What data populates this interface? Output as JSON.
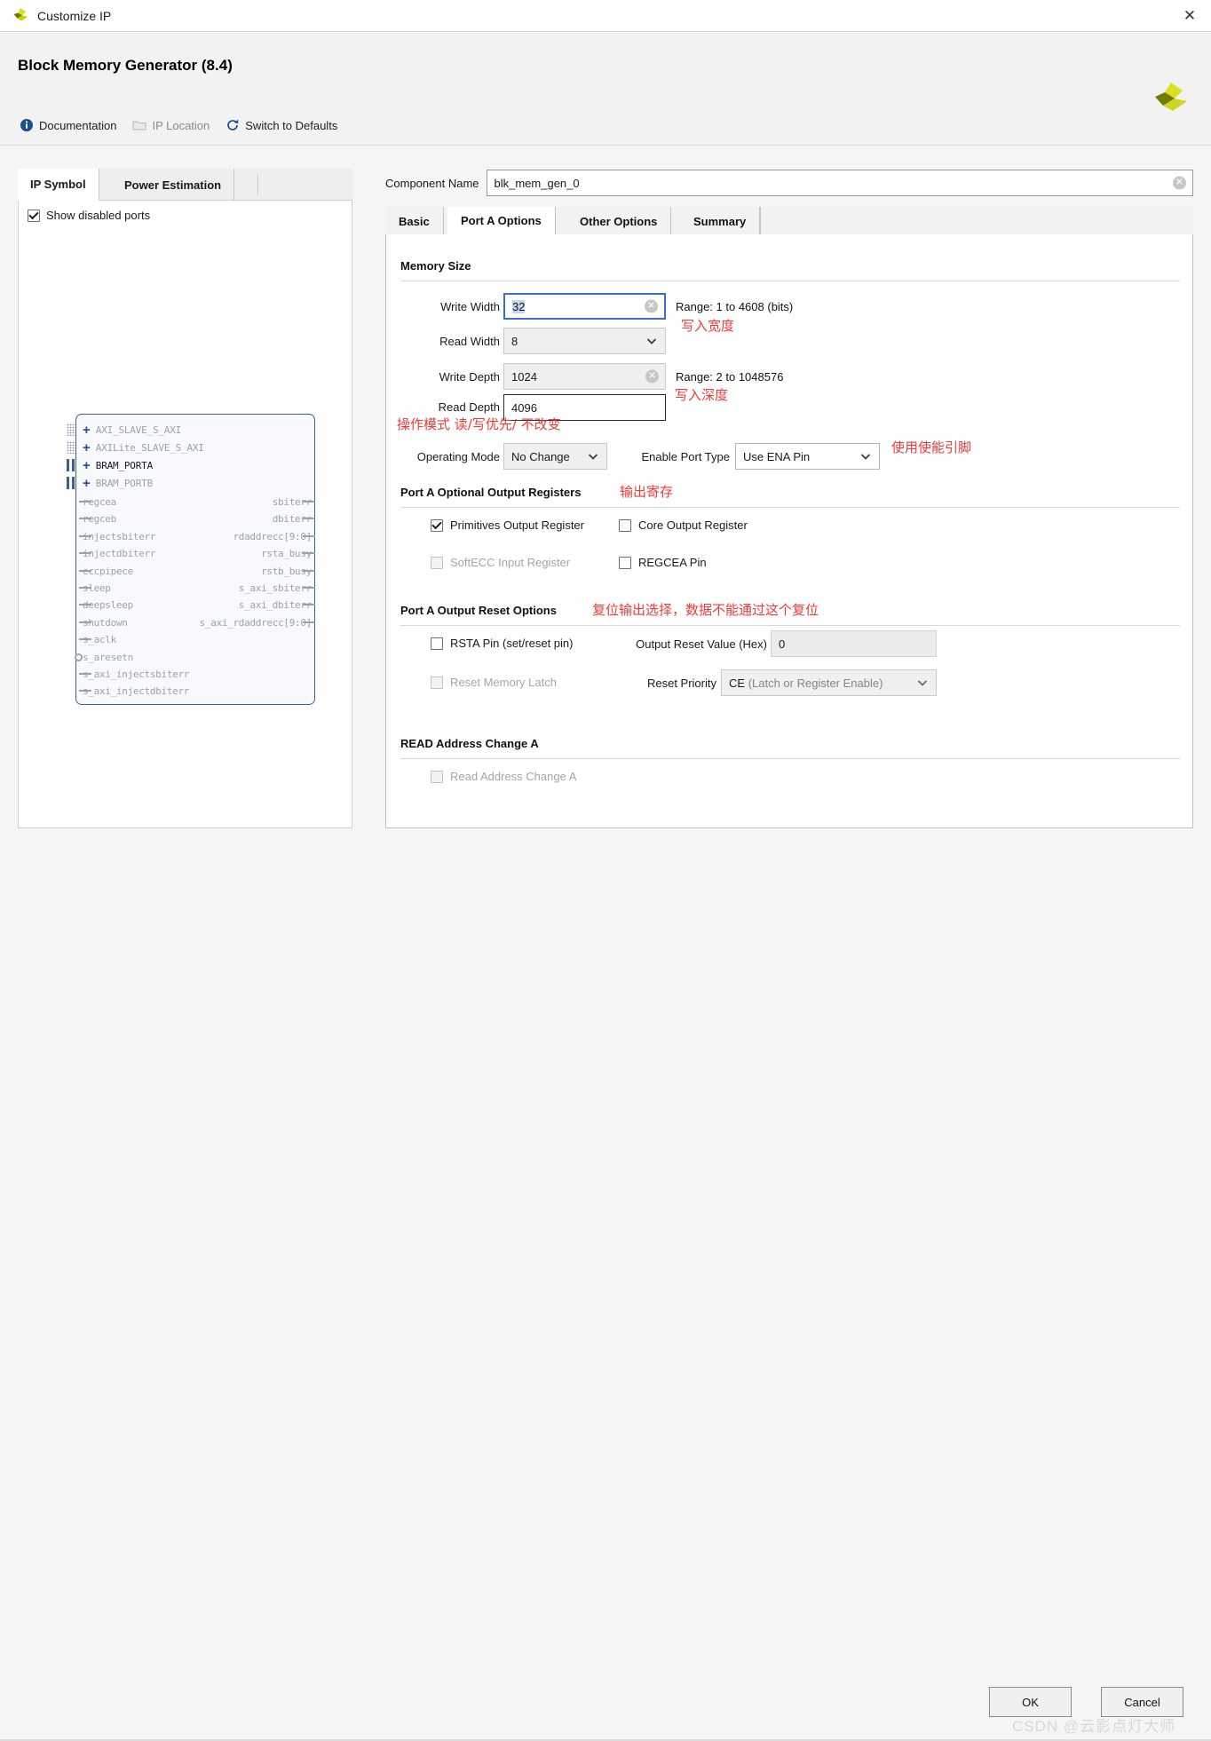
{
  "window": {
    "title": "Customize IP",
    "close_icon": "close-icon",
    "app_icon": "xilinx-logo-icon"
  },
  "header": {
    "ip_title": "Block Memory Generator (8.4)",
    "logo_icon": "xilinx-logo-icon",
    "links": [
      {
        "label": "Documentation",
        "icon": "info-icon",
        "disabled": false
      },
      {
        "label": "IP Location",
        "icon": "folder-icon",
        "disabled": true
      },
      {
        "label": "Switch to Defaults",
        "icon": "refresh-icon",
        "disabled": false
      }
    ]
  },
  "left_panel": {
    "tabs": [
      {
        "label": "IP Symbol",
        "active": true
      },
      {
        "label": "Power Estimation",
        "active": false
      }
    ],
    "show_disabled_ports": {
      "label": "Show disabled ports",
      "checked": true
    },
    "symbol": {
      "buses": [
        {
          "name": "AXI_SLAVE_S_AXI",
          "enabled": false,
          "conn": "dotted"
        },
        {
          "name": "AXILite_SLAVE_S_AXI",
          "enabled": false,
          "conn": "dotted"
        },
        {
          "name": "BRAM_PORTA",
          "enabled": true,
          "conn": "solid"
        },
        {
          "name": "BRAM_PORTB",
          "enabled": false,
          "conn": "solid"
        }
      ],
      "left_pins": [
        {
          "name": "regcea",
          "bubble": false
        },
        {
          "name": "regceb",
          "bubble": false
        },
        {
          "name": "injectsbiterr",
          "bubble": false
        },
        {
          "name": "injectdbiterr",
          "bubble": false
        },
        {
          "name": "eccpipece",
          "bubble": false
        },
        {
          "name": "sleep",
          "bubble": false
        },
        {
          "name": "deepsleep",
          "bubble": false
        },
        {
          "name": "shutdown",
          "bubble": false
        },
        {
          "name": "s_aclk",
          "bubble": false
        },
        {
          "name": "s_aresetn",
          "bubble": true
        },
        {
          "name": "s_axi_injectsbiterr",
          "bubble": false
        },
        {
          "name": "s_axi_injectdbiterr",
          "bubble": false
        }
      ],
      "right_pins": [
        {
          "name": "sbiterr"
        },
        {
          "name": "dbiterr"
        },
        {
          "name": "rdaddrecc[9:0]"
        },
        {
          "name": "rsta_busy"
        },
        {
          "name": "rstb_busy"
        },
        {
          "name": "s_axi_sbiterr"
        },
        {
          "name": "s_axi_dbiterr"
        },
        {
          "name": "s_axi_rdaddrecc[9:0]"
        }
      ]
    }
  },
  "right_panel": {
    "component_name": {
      "label": "Component Name",
      "value": "blk_mem_gen_0",
      "clear_icon": "clear-icon"
    },
    "tabs": [
      {
        "label": "Basic",
        "active": false
      },
      {
        "label": "Port A Options",
        "active": true
      },
      {
        "label": "Other Options",
        "active": false
      },
      {
        "label": "Summary",
        "active": false
      }
    ],
    "memory_size": {
      "heading": "Memory Size",
      "write_width": {
        "label": "Write Width",
        "value": "32",
        "range": "Range: 1 to 4608 (bits)",
        "focused": true
      },
      "read_width": {
        "label": "Read Width",
        "value": "8"
      },
      "write_depth": {
        "label": "Write Depth",
        "value": "1024",
        "range": "Range: 2 to 1048576"
      },
      "read_depth": {
        "label": "Read Depth",
        "value": "4096"
      },
      "operating_mode": {
        "label": "Operating Mode",
        "value": "No Change"
      },
      "enable_port_type": {
        "label": "Enable Port Type",
        "value": "Use ENA Pin"
      }
    },
    "optional_output_registers": {
      "heading": "Port A Optional Output Registers",
      "items": [
        {
          "label": "Primitives Output Register",
          "checked": true,
          "disabled": false
        },
        {
          "label": "Core Output Register",
          "checked": false,
          "disabled": false
        },
        {
          "label": "SoftECC Input Register",
          "checked": false,
          "disabled": true
        },
        {
          "label": "REGCEA Pin",
          "checked": false,
          "disabled": false
        }
      ]
    },
    "output_reset_options": {
      "heading": "Port A Output Reset Options",
      "rsta_pin": {
        "label": "RSTA Pin (set/reset pin)",
        "checked": false,
        "disabled": false
      },
      "reset_memory_latch": {
        "label": "Reset Memory Latch",
        "checked": false,
        "disabled": true
      },
      "output_reset_value": {
        "label": "Output Reset Value (Hex)",
        "value": "0"
      },
      "reset_priority": {
        "label": "Reset Priority",
        "value_strong": "CE",
        "value_dim": "(Latch or Register Enable)"
      }
    },
    "read_address_change": {
      "heading": "READ Address Change A",
      "checkbox": {
        "label": "Read Address Change A",
        "checked": false,
        "disabled": true
      }
    }
  },
  "annotations": [
    {
      "id": "ann-write-width",
      "text": "写入宽度"
    },
    {
      "id": "ann-write-depth",
      "text": "写入深度"
    },
    {
      "id": "ann-operating-mode",
      "text": "操作模式  读/写优先/ 不改变"
    },
    {
      "id": "ann-enable-pin",
      "text": "使用使能引脚"
    },
    {
      "id": "ann-output-reg",
      "text": "输出寄存"
    },
    {
      "id": "ann-reset",
      "text": "复位输出选择，数据不能通过这个复位"
    }
  ],
  "footer": {
    "ok_label": "OK",
    "cancel_label": "Cancel",
    "watermark": "CSDN @云影点灯大师"
  },
  "colors": {
    "accent_blue": "#3c6fc4",
    "annotation_red": "#ef3b36",
    "symbol_border": "#3e5e96",
    "xilinx_green": "#c8d300"
  }
}
